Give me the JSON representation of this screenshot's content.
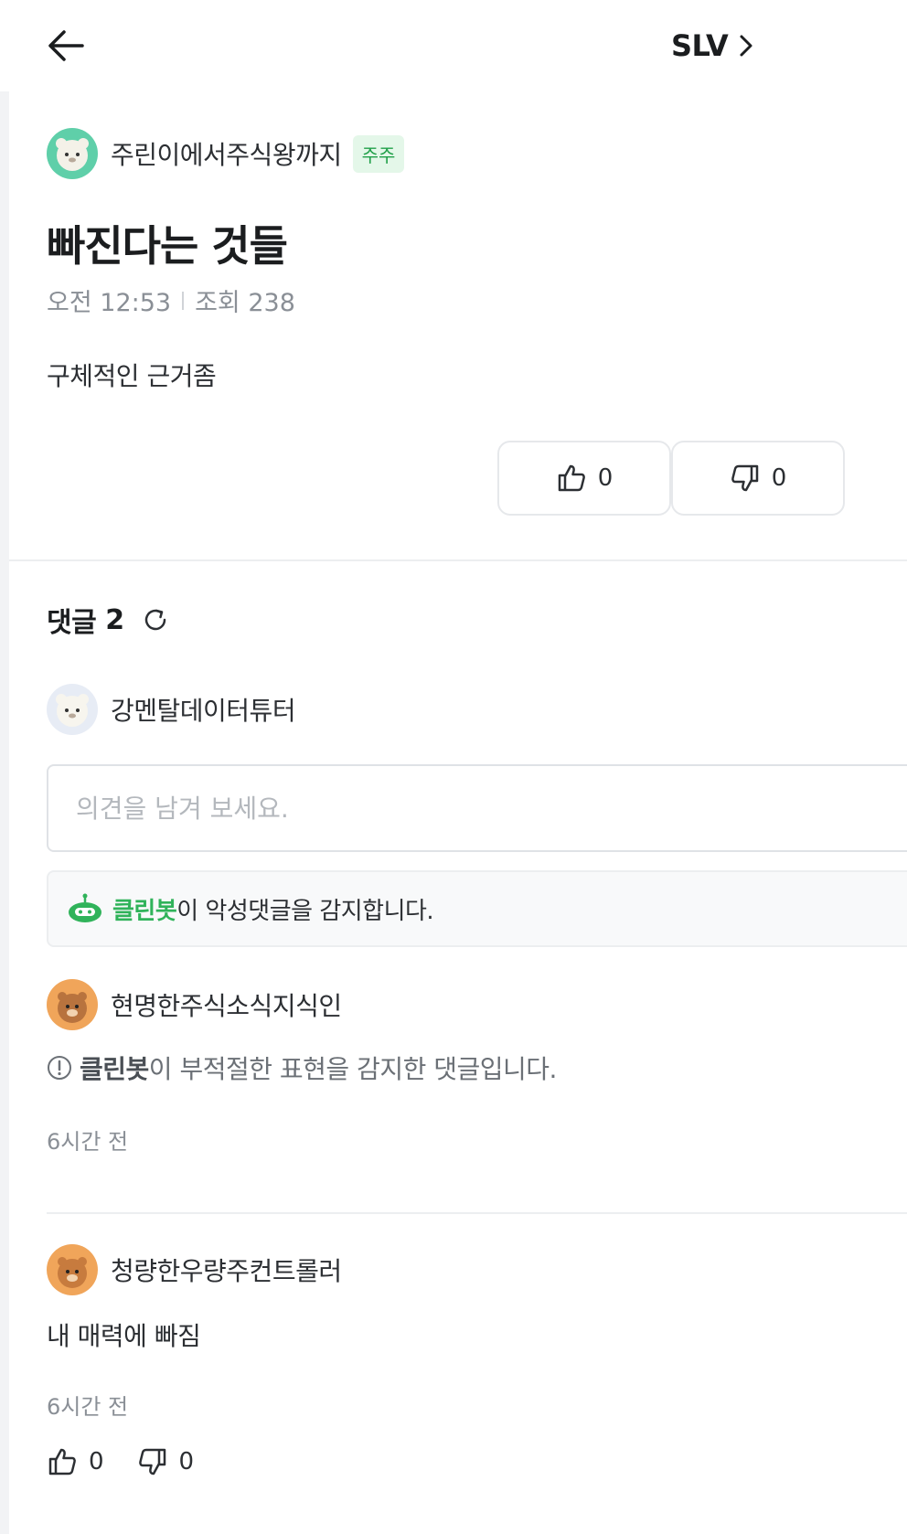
{
  "header": {
    "ticker": "SLV"
  },
  "post": {
    "author": "주린이에서주식왕까지",
    "badge": "주주",
    "title": "빠진다는 것들",
    "time": "오전 12:53",
    "views_label": "조회 238",
    "body": "구체적인 근거좀",
    "likes": "0",
    "dislikes": "0"
  },
  "comments_section": {
    "label": "댓글",
    "count": "2",
    "current_user": "강멘탈데이터튜터",
    "input_placeholder": "의견을 남겨 보세요.",
    "cleanbot_name": "클린봇",
    "cleanbot_notice": "이 악성댓글을 감지합니다."
  },
  "comments": [
    {
      "author": "현명한주식소식지식인",
      "blocked_bot": "클린봇",
      "blocked_text": "이 부적절한 표현을 감지한 댓글입니다.",
      "time": "6시간 전"
    },
    {
      "author": "청량한우량주컨트롤러",
      "text": "내 매력에 빠짐",
      "time": "6시간 전",
      "likes": "0",
      "dislikes": "0"
    }
  ],
  "colors": {
    "accent_green": "#30b35a",
    "badge_bg": "#e4f7e9",
    "avatar_teal": "#5fcfa9",
    "avatar_orange": "#f0a55a"
  },
  "icons": [
    "back-arrow-icon",
    "chevron-right-icon",
    "thumbs-up-icon",
    "thumbs-down-icon",
    "refresh-icon",
    "cleanbot-icon",
    "info-circle-icon"
  ]
}
